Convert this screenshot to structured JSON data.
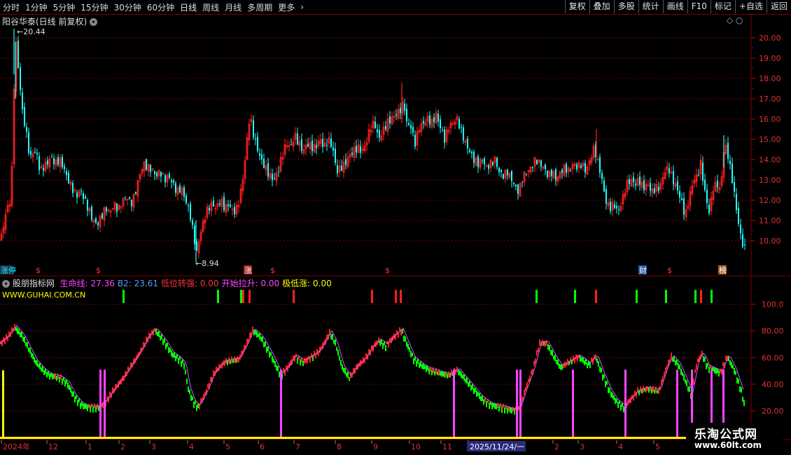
{
  "toolbar": {
    "periods": [
      "分时",
      "1分钟",
      "5分钟",
      "15分钟",
      "30分钟",
      "60分钟",
      "日线",
      "周线",
      "月线",
      "多周期",
      "更多"
    ],
    "more_arrow": "›",
    "right_buttons": [
      "复权",
      "叠加",
      "多股",
      "统计",
      "画线",
      "F10",
      "标记",
      "+自选",
      "返回"
    ]
  },
  "main": {
    "title": "阳谷华泰(日线 前复权)",
    "max_label": "20.44",
    "min_label": "8.94",
    "y_ticks": [
      "20.00",
      "19.00",
      "18.00",
      "17.00",
      "16.00",
      "15.00",
      "14.00",
      "13.00",
      "12.00",
      "11.00",
      "10.00"
    ],
    "markers": [
      "涨停",
      "$",
      "$",
      "涨",
      "$",
      "$",
      "财",
      "$",
      "榜"
    ]
  },
  "indicator": {
    "title": "股朋指标网",
    "items": [
      {
        "label": "生命线:",
        "value": "27.36",
        "color": "#ff44ff"
      },
      {
        "label": "B2:",
        "value": "23.61",
        "color": "#5599ff"
      },
      {
        "label": "低位转强:",
        "value": "0.00",
        "color": "#ff3333"
      },
      {
        "label": "开始拉升:",
        "value": "0.00",
        "color": "#ff44ff"
      },
      {
        "label": "极低涨:",
        "value": "0.00",
        "color": "#ffff00"
      }
    ],
    "site": "WWW.GUHAI.COM.CN",
    "y_ticks": [
      "100.0",
      "80.00",
      "60.00",
      "40.00",
      "20.00"
    ]
  },
  "time_axis": {
    "labels": [
      "2024年",
      "12",
      "1",
      "2",
      "3",
      "4",
      "5",
      "6",
      "7",
      "8",
      "9",
      "10",
      "11",
      "2025/11/24/一",
      "2",
      "3",
      "4",
      "5"
    ]
  },
  "watermark": {
    "name": "乐淘公式网",
    "url": "www.60lt.com"
  },
  "colors": {
    "up": "#ff2020",
    "down": "#20ffff",
    "green": "#00ff00",
    "magenta": "#ff44ff",
    "yellow": "#ffff00",
    "grid": "#7a0000"
  }
}
